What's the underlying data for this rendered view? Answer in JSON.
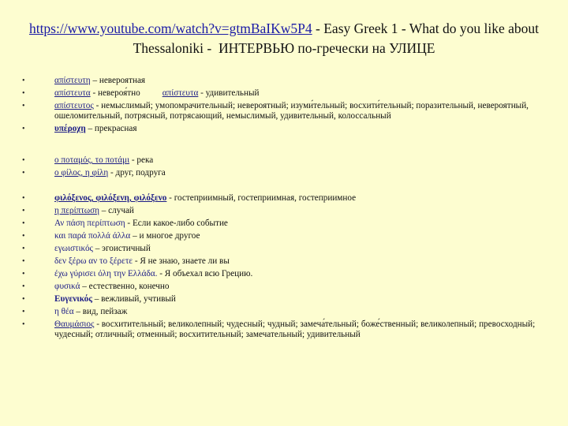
{
  "title": {
    "url": "https://www.youtube.com/watch?v=gtmBaIKw5P4",
    "rest": " - Easy Greek 1 - What do you like about Thessaloniki -  ИНТЕРВЬЮ по-гречески на УЛИЦЕ"
  },
  "group1": [
    {
      "gr": "απίστευτη",
      "ru": " – невероятная"
    },
    {
      "gr": "απίστευτα",
      "ru": " - невероя́тно",
      "gr2": "απίστευτα",
      "ru2": " - удивительный"
    },
    {
      "gr": "απίστευτος",
      "ru": " - немыслимый; умопомрачительный; невероятный; изуми́тельный; восхити́тельный; поразительный, невероятный, ошеломительный, потрясный, потрясающий, немыслимый, удивительный, колоссальный"
    },
    {
      "gr": "υπέροχη",
      "ru": " – прекрасная"
    }
  ],
  "group2": [
    {
      "gr": "ο ποταμός, το ποτάμι",
      "ru": " - река"
    },
    {
      "gr": "ο φίλος, η φίλη",
      "ru": " - друг, подруга"
    }
  ],
  "group3": [
    {
      "gr": "φιλόξενος, φιλόξενη, φιλόξενο",
      "ru": " - гостеприимный, гостеприимная, гостеприимное"
    },
    {
      "gr": "η περίπτωση",
      "ru": " – случай"
    },
    {
      "gr": "Αν πάση περίπτωση",
      "ru": " - Если какое-либо событие"
    },
    {
      "gr": "και παρά πολλά άλλα",
      "ru": " – и многое другое"
    },
    {
      "gr": "εγωιστικός",
      "ru": " – эгоистичный"
    },
    {
      "gr": "δεν ξέρω αν το ξέρετε",
      "ru": " - Я не знаю, знаете ли вы"
    },
    {
      "gr": "έχω γύρισει όλη την Ελλάδα.",
      "ru": " - Я объехал всю Грецию."
    },
    {
      "gr": "φυσικά",
      "ru": " – естественно, конечно"
    },
    {
      "gr": "Ευγενικός",
      "ru": " – вежливый, учтивый"
    },
    {
      "gr": "η θέα",
      "ru": " – вид, пейзаж"
    },
    {
      "gr": "Θαυμάσιος",
      "ru": " - восхитительный; великолепный; чудесный; чудный; замеча́тельный; боже́ственный; великолепный; превосходный; чудесный; отличный; отменный; восхитительный; замечательный; удивительный"
    }
  ]
}
